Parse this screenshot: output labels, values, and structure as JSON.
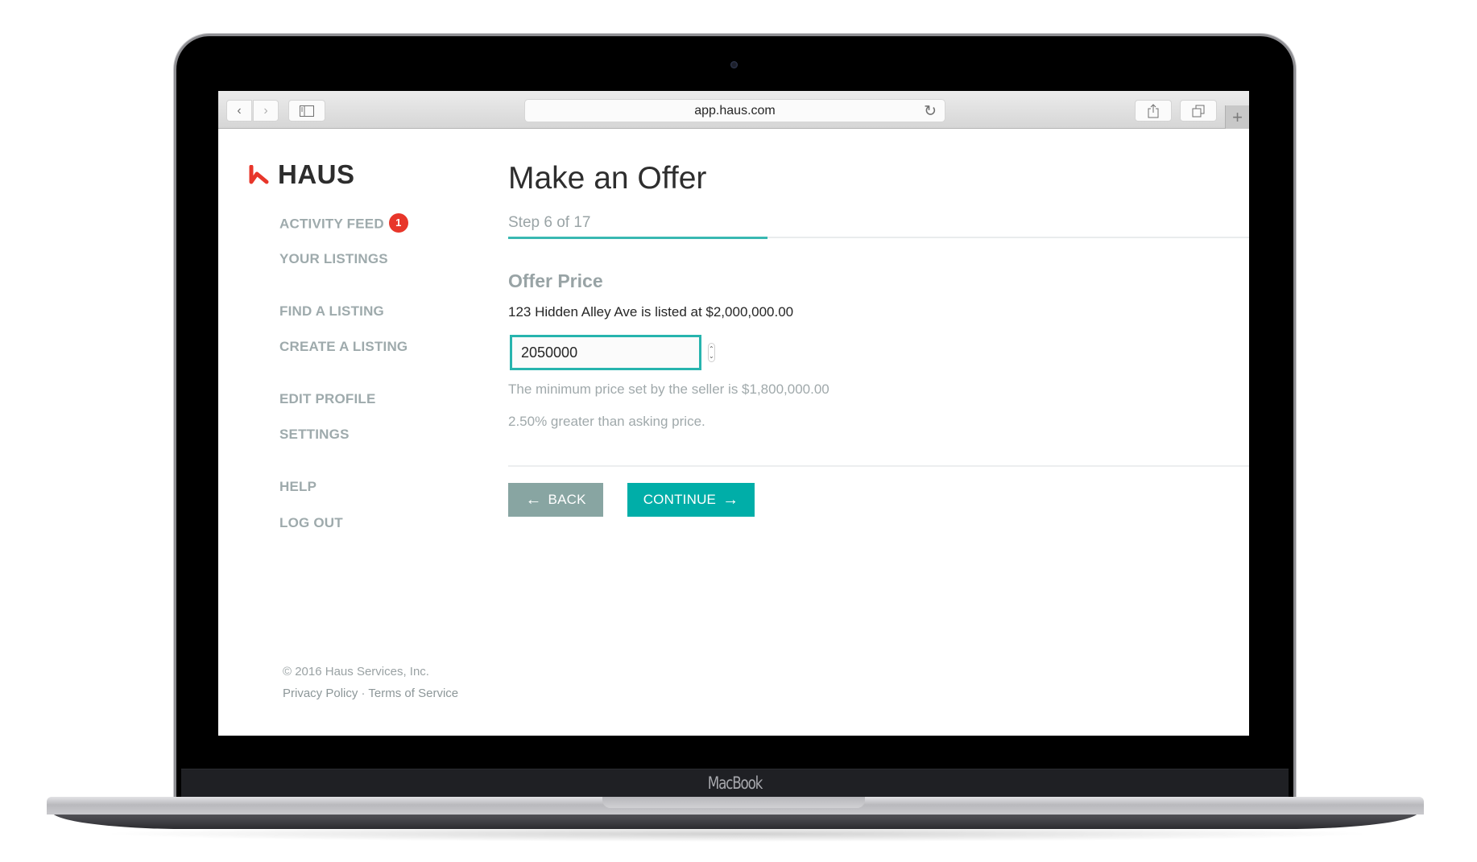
{
  "device": {
    "label": "MacBook"
  },
  "browser": {
    "url": "app.haus.com",
    "icons": {
      "back": "chevron-left-icon",
      "forward": "chevron-right-icon",
      "sidebar": "sidebar-icon",
      "reload": "reload-icon",
      "share": "share-icon",
      "tabs": "tabs-overview-icon",
      "new_tab": "plus-icon"
    }
  },
  "brand": {
    "name": "HAUS",
    "accent": "#e8362a"
  },
  "sidebar": {
    "items": [
      {
        "label": "ACTIVITY FEED",
        "badge": "1"
      },
      {
        "label": "YOUR LISTINGS"
      },
      {
        "label": "FIND A LISTING"
      },
      {
        "label": "CREATE A LISTING"
      },
      {
        "label": "EDIT PROFILE"
      },
      {
        "label": "SETTINGS"
      },
      {
        "label": "HELP"
      },
      {
        "label": "LOG OUT"
      }
    ],
    "footer": {
      "copyright": "© 2016 Haus Services, Inc.",
      "privacy": "Privacy Policy",
      "separator": " · ",
      "terms": "Terms of Service"
    }
  },
  "main": {
    "title": "Make an Offer",
    "step": {
      "label": "Step 6 of 17",
      "current": 6,
      "total": 17,
      "progress_fraction": 0.35
    },
    "section_title": "Offer Price",
    "listing_info": "123 Hidden Alley Ave is listed at $2,000,000.00",
    "offer_input": {
      "value": "2050000"
    },
    "min_price_hint": "The minimum price set by the seller is $1,800,000.00",
    "percent_hint": "2.50% greater than asking price.",
    "buttons": {
      "back": "BACK",
      "continue": "CONTINUE"
    },
    "colors": {
      "teal": "#00aea8",
      "back_button": "#88a5a2"
    }
  }
}
